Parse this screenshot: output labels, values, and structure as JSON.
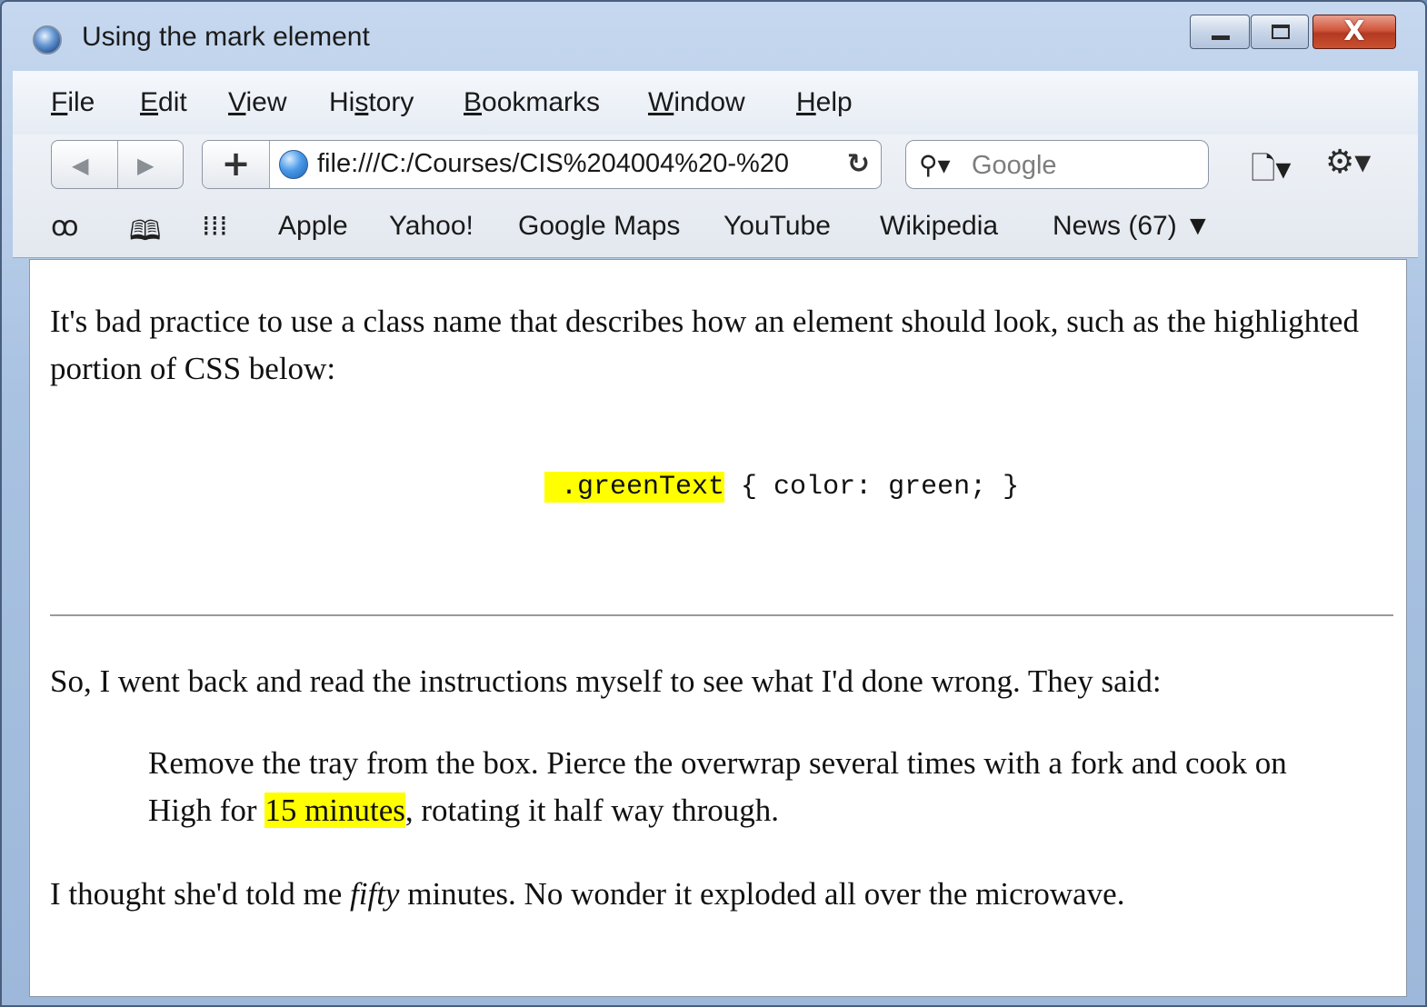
{
  "window": {
    "title": "Using the mark element"
  },
  "menu": {
    "items": [
      {
        "key": "F",
        "rest": "ile"
      },
      {
        "key": "E",
        "rest": "dit"
      },
      {
        "key": "V",
        "rest": "iew"
      },
      {
        "pre": "Hi",
        "key": "s",
        "rest": "tory"
      },
      {
        "key": "B",
        "rest": "ookmarks"
      },
      {
        "key": "W",
        "rest": "indow"
      },
      {
        "key": "H",
        "rest": "elp"
      }
    ]
  },
  "toolbar": {
    "url": "file:///C:/Courses/CIS%204004%20-%20",
    "search_placeholder": "Google"
  },
  "bookmarks": {
    "items": [
      "Apple",
      "Yahoo!",
      "Google Maps",
      "YouTube",
      "Wikipedia",
      "News (67) ▼"
    ]
  },
  "content": {
    "intro": "It's bad practice to use a class name that describes how an element should look, such as the highlighted portion of CSS below:",
    "code_mark": " .greenText",
    "code_rest": " { color: green; }",
    "p2": "So, I went back and read the instructions myself to see what I'd done wrong. They said:",
    "quote_before": "Remove the tray from the box. Pierce the overwrap several times with a fork and cook on High for ",
    "quote_mark": "15 minutes",
    "quote_after": ", rotating it half way through.",
    "p3_before": "I thought she'd told me ",
    "p3_em": "fifty",
    "p3_after": " minutes. No wonder it exploded all over the microwave."
  }
}
